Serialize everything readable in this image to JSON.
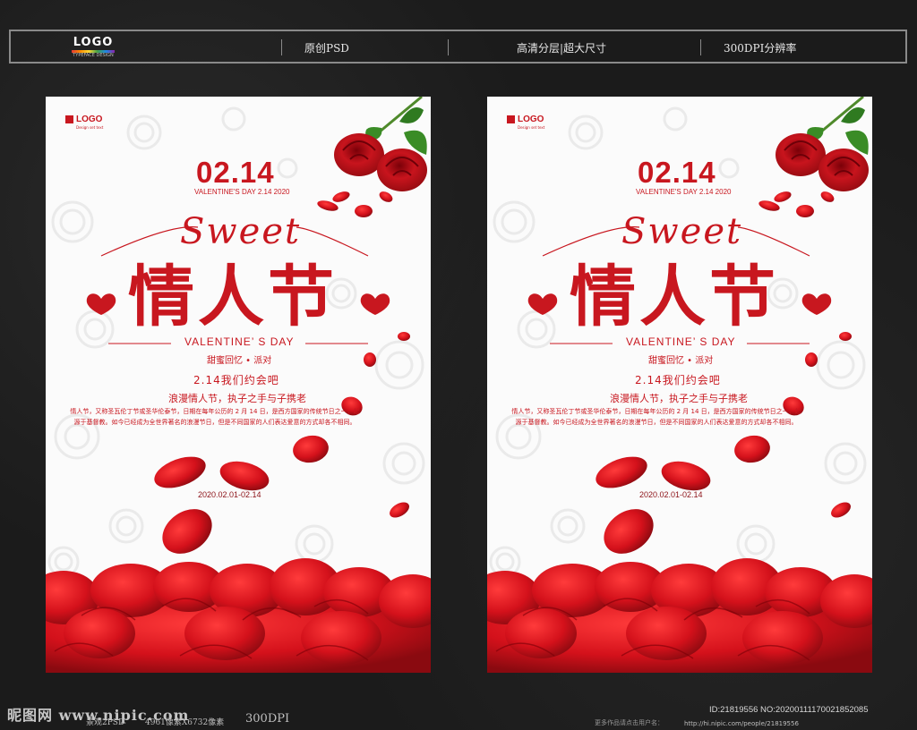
{
  "header": {
    "logo_text": "LOGO",
    "logo_subtext": "TYPEFACE DESIGN",
    "items": [
      "原创PSD",
      "高清分层|超大尺寸",
      "300DPI分辨率"
    ]
  },
  "poster": {
    "logo_text": "LOGO",
    "logo_subtext": "Design set text",
    "date": "02.14",
    "date_sub": "VALENTINE'S DAY 2.14 2020",
    "script_title": "Sweet",
    "main_title": "情人节",
    "english_title": "VALENTINE’ S DAY",
    "subtitle": "甜蜜回忆 • 派对",
    "date_line": "2.14我们约会吧",
    "slogan": "浪漫情人节，执子之手与子携老",
    "paragraph": "情人节，又称圣瓦伦丁节或圣华伦泰节，日期在每年公历的 2 月 14 日，是西方国家的传统节日之一，起源于基督教。如今已经成为全世界著名的浪漫节日，但是不同国家的人们表达爱意的方式却各不相同。",
    "date_range": "2020.02.01-02.14"
  },
  "footer": {
    "site": "昵图网 www.nipic.com",
    "text1": "景观2PSD",
    "text2": "4961像素X6732像素",
    "text3": "300DPI",
    "text4": "更多作品请点击用户名：",
    "id_line": "ID:21819556 NO:20200111170021852085",
    "url": "http://hi.nipic.com/people/21819556"
  },
  "colors": {
    "accent": "#c8171f",
    "petal": "#d4111b",
    "background": "#1b1b1b",
    "poster_bg": "#fbfbfb"
  }
}
